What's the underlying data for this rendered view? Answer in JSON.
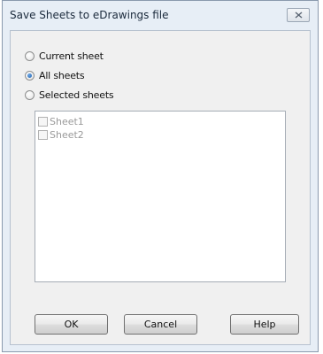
{
  "window": {
    "title": "Save Sheets to eDrawings file"
  },
  "options": {
    "current_sheet": "Current sheet",
    "all_sheets": "All sheets",
    "selected_sheets": "Selected sheets",
    "selected": "all_sheets"
  },
  "sheets": [
    {
      "label": "Sheet1",
      "checked": false
    },
    {
      "label": "Sheet2",
      "checked": false
    }
  ],
  "buttons": {
    "ok": "OK",
    "cancel": "Cancel",
    "help": "Help"
  },
  "icons": {
    "close": "close-icon"
  },
  "colors": {
    "title_bar": "#e7eef6",
    "radio_selected": "#1b5fae"
  }
}
